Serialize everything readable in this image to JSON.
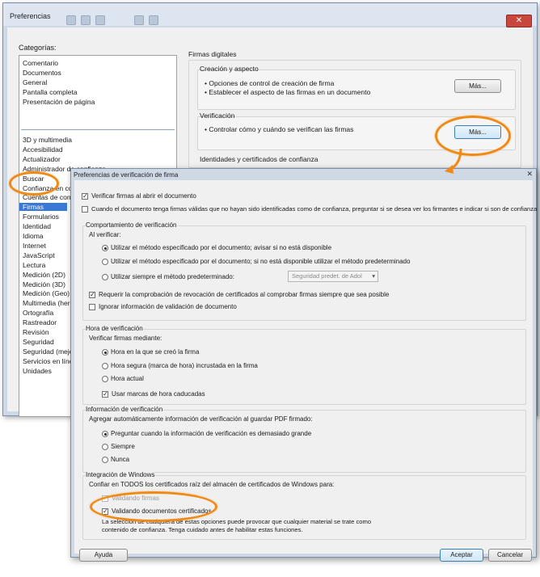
{
  "pref_window": {
    "title": "Preferencias",
    "close_glyph": "✕",
    "categories_label": "Categorías:",
    "categories_top": [
      "Comentario",
      "Documentos",
      "General",
      "Pantalla completa",
      "Presentación de página"
    ],
    "categories": [
      "3D y multimedia",
      "Accesibilidad",
      "Actualizador",
      "Administrador de confianza",
      "Buscar",
      "Confianza en contenido multimedia (heredado)",
      "Cuentas de corre",
      "Firmas",
      "Formularios",
      "Identidad",
      "Idioma",
      "Internet",
      "JavaScript",
      "Lectura",
      "Medición (2D)",
      "Medición (3D)",
      "Medición (Geo)",
      "Multimedia (hered",
      "Ortografía",
      "Rastreador",
      "Revisión",
      "Seguridad",
      "Seguridad (mejor",
      "Servicios en línea",
      "Unidades"
    ],
    "selected_category": "Firmas",
    "section_title": "Firmas digitales",
    "creation": {
      "title": "Creación y aspecto",
      "bullet1": "• Opciones de control de creación de firma",
      "bullet2": "• Establecer el aspecto de las firmas en un documento",
      "button": "Más..."
    },
    "verification": {
      "title": "Verificación",
      "bullet1": "• Controlar cómo y cuándo se verifican las firmas",
      "button": "Más..."
    },
    "identities_title": "Identidades y certificados de confianza"
  },
  "sig_window": {
    "title": "Preferencias de verificación de firma",
    "close_glyph": "✕",
    "verify_on_open": "Verificar firmas al abrir el documento",
    "warn_untrusted": "Cuando el documento tenga firmas válidas que no hayan sido identificadas como de confianza, preguntar si se desea ver los firmantes e indicar si son de confianza",
    "behavior": {
      "title": "Comportamiento de verificación",
      "when_verifying": "Al verificar:",
      "opt1": "Utilizar el método especificado por el documento; avisar si no está disponible",
      "opt2": "Utilizar el método especificado por el documento; si no está disponible utilizar el método predeterminado",
      "opt3": "Utilizar siempre el método predeterminado:",
      "default_method": "Seguridad predet. de Adol",
      "revocation": "Requerir la comprobación de revocación de certificados al comprobar firmas siempre que sea posible",
      "ignore_validation": "Ignorar información de validación de documento"
    },
    "time": {
      "title": "Hora de verificación",
      "subtitle": "Verificar firmas mediante:",
      "opt1": "Hora en la que se creó la firma",
      "opt2": "Hora segura (marca de hora) incrustada en la firma",
      "opt3": "Hora actual",
      "expired": "Usar marcas de hora caducadas"
    },
    "info": {
      "title": "Información de verificación",
      "subtitle": "Agregar automáticamente información de verificación al guardar PDF firmado:",
      "opt1": "Preguntar cuando la información de verificación es demasiado grande",
      "opt2": "Siempre",
      "opt3": "Nunca"
    },
    "windows": {
      "title": "Integración de Windows",
      "subtitle": "Confiar en TODOS los certificados raíz del almacén de certificados de Windows para:",
      "opt1": "Validando firmas",
      "opt2": "Validando documentos certificados",
      "warning_line1": "La selección de cualquiera de estas opciones puede provocar que cualquier material se trate como",
      "warning_line2": "contenido de confianza. Tenga cuidado antes de habilitar estas funciones."
    },
    "help_button": "Ayuda",
    "ok_button": "Aceptar",
    "cancel_button": "Cancelar"
  },
  "annotation_color": "#f08a14"
}
